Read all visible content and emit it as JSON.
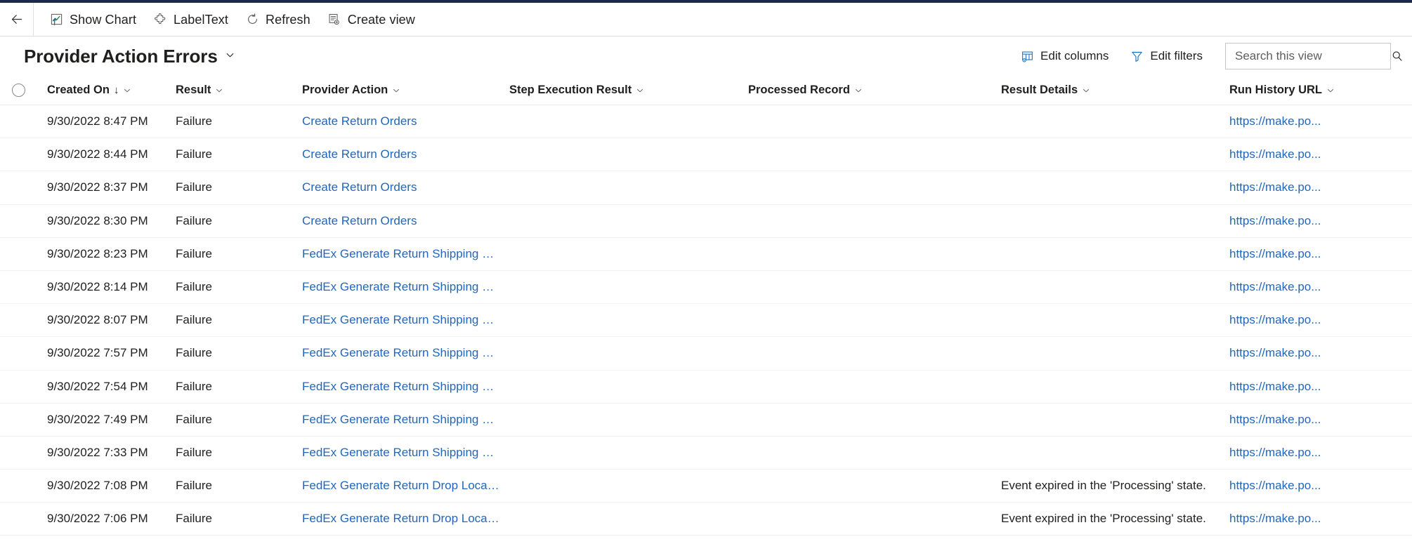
{
  "app": {
    "accent_color": "#2266bb",
    "strip_color": "#1b2a4b"
  },
  "command_bar": {
    "back_label": "Back",
    "items": [
      {
        "label": "Show Chart",
        "icon": "show-chart-icon"
      },
      {
        "label": "LabelText",
        "icon": "puzzle-piece-icon"
      },
      {
        "label": "Refresh",
        "icon": "refresh-icon"
      },
      {
        "label": "Create view",
        "icon": "create-view-icon"
      }
    ]
  },
  "title_bar": {
    "title": "Provider Action Errors",
    "dropdown_chevron": "⌄",
    "edit_columns_label": "Edit columns",
    "edit_filters_label": "Edit filters",
    "search": {
      "placeholder": "Search this view",
      "value": ""
    }
  },
  "grid": {
    "select_all_label": "Select all rows",
    "columns": [
      {
        "key": "created_on",
        "label": "Created On",
        "sorted": true,
        "sort_arrow": "↓"
      },
      {
        "key": "result",
        "label": "Result",
        "sorted": false
      },
      {
        "key": "provider_action",
        "label": "Provider Action",
        "sorted": false
      },
      {
        "key": "step_execution_result",
        "label": "Step Execution Result",
        "sorted": false
      },
      {
        "key": "processed_record",
        "label": "Processed Record",
        "sorted": false
      },
      {
        "key": "result_details",
        "label": "Result Details",
        "sorted": false
      },
      {
        "key": "run_history_url",
        "label": "Run History URL",
        "sorted": false
      }
    ],
    "rows": [
      {
        "created_on": "9/30/2022 8:47 PM",
        "result": "Failure",
        "provider_action": "Create Return Orders",
        "step_execution_result": "",
        "processed_record": "",
        "result_details": "",
        "run_history_url": "https://make.po..."
      },
      {
        "created_on": "9/30/2022 8:44 PM",
        "result": "Failure",
        "provider_action": "Create Return Orders",
        "step_execution_result": "",
        "processed_record": "",
        "result_details": "",
        "run_history_url": "https://make.po..."
      },
      {
        "created_on": "9/30/2022 8:37 PM",
        "result": "Failure",
        "provider_action": "Create Return Orders",
        "step_execution_result": "",
        "processed_record": "",
        "result_details": "",
        "run_history_url": "https://make.po..."
      },
      {
        "created_on": "9/30/2022 8:30 PM",
        "result": "Failure",
        "provider_action": "Create Return Orders",
        "step_execution_result": "",
        "processed_record": "",
        "result_details": "",
        "run_history_url": "https://make.po..."
      },
      {
        "created_on": "9/30/2022 8:23 PM",
        "result": "Failure",
        "provider_action": "FedEx Generate Return Shipping La...",
        "step_execution_result": "",
        "processed_record": "",
        "result_details": "",
        "run_history_url": "https://make.po..."
      },
      {
        "created_on": "9/30/2022 8:14 PM",
        "result": "Failure",
        "provider_action": "FedEx Generate Return Shipping La...",
        "step_execution_result": "",
        "processed_record": "",
        "result_details": "",
        "run_history_url": "https://make.po..."
      },
      {
        "created_on": "9/30/2022 8:07 PM",
        "result": "Failure",
        "provider_action": "FedEx Generate Return Shipping La...",
        "step_execution_result": "",
        "processed_record": "",
        "result_details": "",
        "run_history_url": "https://make.po..."
      },
      {
        "created_on": "9/30/2022 7:57 PM",
        "result": "Failure",
        "provider_action": "FedEx Generate Return Shipping La...",
        "step_execution_result": "",
        "processed_record": "",
        "result_details": "",
        "run_history_url": "https://make.po..."
      },
      {
        "created_on": "9/30/2022 7:54 PM",
        "result": "Failure",
        "provider_action": "FedEx Generate Return Shipping La...",
        "step_execution_result": "",
        "processed_record": "",
        "result_details": "",
        "run_history_url": "https://make.po..."
      },
      {
        "created_on": "9/30/2022 7:49 PM",
        "result": "Failure",
        "provider_action": "FedEx Generate Return Shipping La...",
        "step_execution_result": "",
        "processed_record": "",
        "result_details": "",
        "run_history_url": "https://make.po..."
      },
      {
        "created_on": "9/30/2022 7:33 PM",
        "result": "Failure",
        "provider_action": "FedEx Generate Return Shipping La...",
        "step_execution_result": "",
        "processed_record": "",
        "result_details": "",
        "run_history_url": "https://make.po..."
      },
      {
        "created_on": "9/30/2022 7:08 PM",
        "result": "Failure",
        "provider_action": "FedEx Generate Return Drop Locati...",
        "step_execution_result": "",
        "processed_record": "",
        "result_details": "Event expired in the 'Processing' state.",
        "run_history_url": "https://make.po..."
      },
      {
        "created_on": "9/30/2022 7:06 PM",
        "result": "Failure",
        "provider_action": "FedEx Generate Return Drop Locati...",
        "step_execution_result": "",
        "processed_record": "",
        "result_details": "Event expired in the 'Processing' state.",
        "run_history_url": "https://make.po..."
      }
    ]
  }
}
